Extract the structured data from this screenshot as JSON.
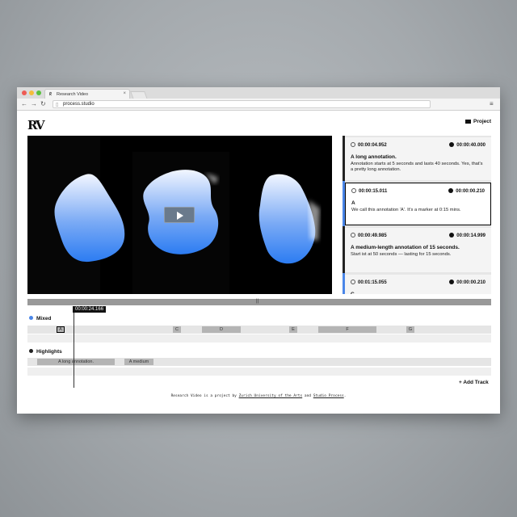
{
  "browser": {
    "tab_title": "Research Video",
    "url": "process.studio",
    "traffic_colors": [
      "#ee5b55",
      "#f4bd3b",
      "#59c13f"
    ]
  },
  "header": {
    "logo": "RV",
    "project_label": "Project"
  },
  "video": {
    "play_icon": "play-icon"
  },
  "annotations": [
    {
      "start": "00:00:04.952",
      "end": "00:00:40.000",
      "title": "A long annotation.",
      "desc": "Annotation starts at 5 seconds and lasts 40 seconds. Yes, that's a pretty long annotation.",
      "bar_color": "#222222"
    },
    {
      "start": "00:00:15.011",
      "end": "00:00:00.210",
      "title": "A",
      "desc": "We call this annotation 'A'. It's a marker at 0:15 mins.",
      "bar_color": "#4a86e8"
    },
    {
      "start": "00:00:49.985",
      "end": "00:00:14.999",
      "title": "A medium-length annotation of 15 seconds.",
      "desc": "Start ist at 50 seconds — lasting for 15 seconds.",
      "bar_color": "#222222"
    },
    {
      "start": "00:01:15.055",
      "end": "00:00:00.210",
      "title": "C",
      "desc": "",
      "bar_color": "#4a86e8"
    }
  ],
  "timeline": {
    "current_time": "00:00:24.166",
    "tracks": [
      {
        "name": "Mixed",
        "dot_color": "#4a86e8",
        "segments": [
          "A",
          "C",
          "D",
          "E",
          "F",
          "G"
        ]
      },
      {
        "name": "Highlights",
        "dot_color": "#222222",
        "segments": [
          "A long annotation.",
          "A medium"
        ]
      }
    ],
    "add_track_label": "+ Add Track"
  },
  "footer": {
    "prefix": "Research Video is a project by",
    "link1": "Zurich University of the Arts",
    "and": "and",
    "link2": "Studio Process",
    "suffix": "."
  }
}
